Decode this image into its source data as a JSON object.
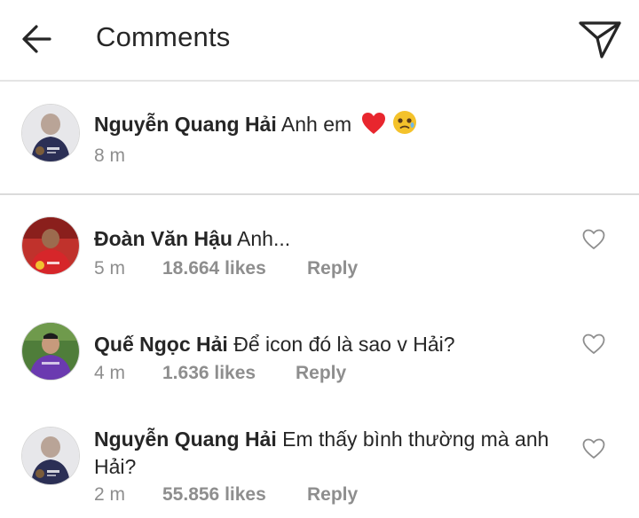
{
  "header": {
    "title": "Comments"
  },
  "caption": {
    "username": "Nguyễn Quang Hải",
    "text": "Anh em",
    "time": "8 m"
  },
  "comments": [
    {
      "username": "Đoàn Văn Hậu",
      "text": "Anh...",
      "time": "5 m",
      "likes": "18.664 likes",
      "reply": "Reply"
    },
    {
      "username": "Quế Ngọc Hải",
      "text": "Để icon đó là sao v Hải?",
      "time": "4 m",
      "likes": "1.636 likes",
      "reply": "Reply"
    },
    {
      "username": "Nguyễn Quang Hải",
      "text": "Em thấy bình thường mà anh Hải?",
      "time": "2 m",
      "likes": "55.856 likes",
      "reply": "Reply"
    }
  ],
  "icons": {
    "back": "arrow-left-icon",
    "send": "paper-plane-icon",
    "like": "heart-outline-icon",
    "emoji_heart": "red-heart-emoji",
    "emoji_face": "pleading-face-emoji"
  },
  "colors": {
    "text": "#262626",
    "meta": "#8e8e8e",
    "divider": "#dbdbdb",
    "heart": "#e8262e",
    "face": "#f4c22b"
  }
}
